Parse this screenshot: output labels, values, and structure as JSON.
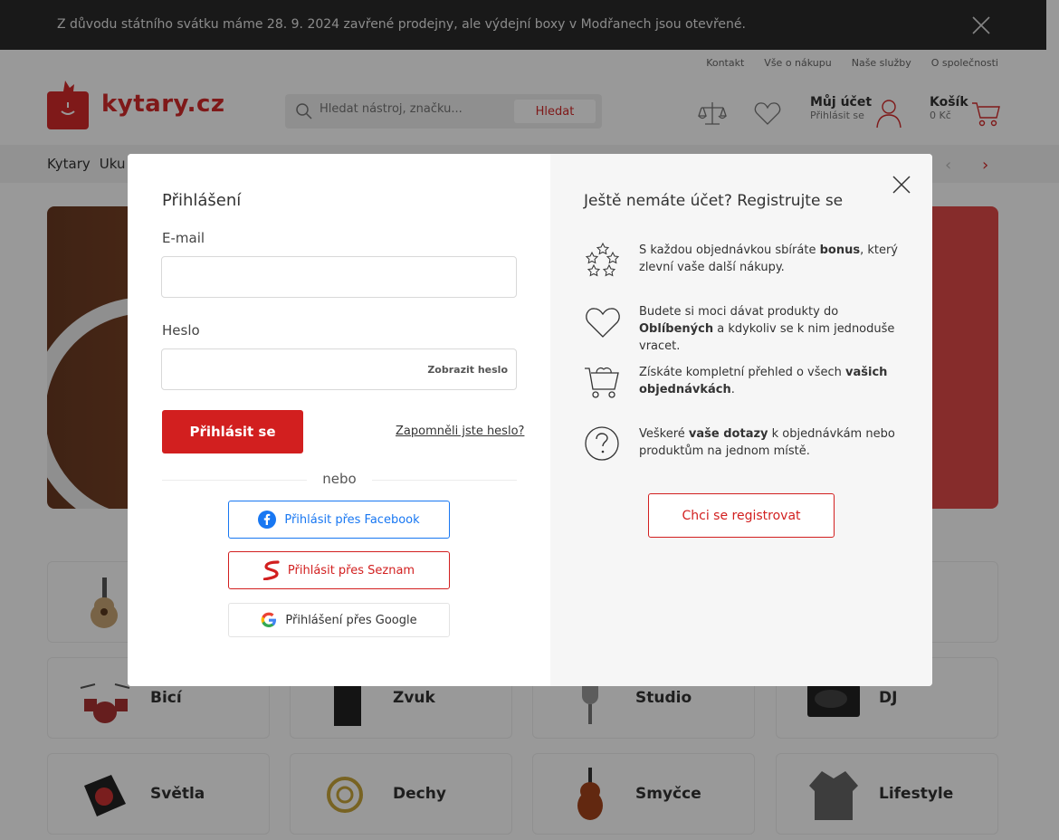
{
  "notice": {
    "text": "Z důvodu státního svátku máme 28. 9. 2024 zavřené prodejny, ale výdejní boxy v Modřanech jsou otevřené."
  },
  "toplinks": [
    "Kontakt",
    "Vše o nákupu",
    "Naše služby",
    "O společnosti"
  ],
  "logo": {
    "text": "kytary.cz"
  },
  "search": {
    "placeholder": "Hledat nástroj, značku...",
    "button": "Hledat"
  },
  "account": {
    "title": "Můj účet",
    "subtitle": "Přihlásit se"
  },
  "cart": {
    "title": "Košík",
    "amount": "0 Kč"
  },
  "catnav": [
    "Kytary",
    "Uku"
  ],
  "tiles": [
    "Bicí",
    "Zvuk",
    "Studio",
    "DJ",
    "Světla",
    "Dechy",
    "Smyčce",
    "Lifestyle"
  ],
  "login": {
    "title": "Přihlášení",
    "email_label": "E-mail",
    "password_label": "Heslo",
    "show_password": "Zobrazit heslo",
    "submit": "Přihlásit se",
    "forgot": "Zapomněli jste heslo?",
    "or": "nebo",
    "facebook": "Přihlásit přes Facebook",
    "seznam": "Přihlásit přes Seznam",
    "google": "Přihlášení přes Google"
  },
  "register": {
    "title": "Ještě nemáte účet? Registrujte se",
    "benefits": [
      {
        "icon": "stars-icon",
        "pre": "S každou objednávkou sbíráte ",
        "bold": "bonus",
        "post": ", který zlevní vaše další nákupy."
      },
      {
        "icon": "heart-icon",
        "pre": "Budete si moci dávat produkty do ",
        "bold": "Oblíbených",
        "post": " a kdykoliv se k nim jednoduše vracet."
      },
      {
        "icon": "basket-icon",
        "pre": "Získáte kompletní přehled o všech ",
        "bold": "vašich objednávkách",
        "post": "."
      },
      {
        "icon": "question-icon",
        "pre": "Veškeré ",
        "bold": "vaše dotazy",
        "post": " k objednávkám nebo produktům na jednom místě."
      }
    ],
    "button": "Chci se registrovat"
  },
  "colors": {
    "brand": "#d21f1f",
    "facebook": "#1877f2",
    "notice_bg": "#2b2b2b"
  }
}
